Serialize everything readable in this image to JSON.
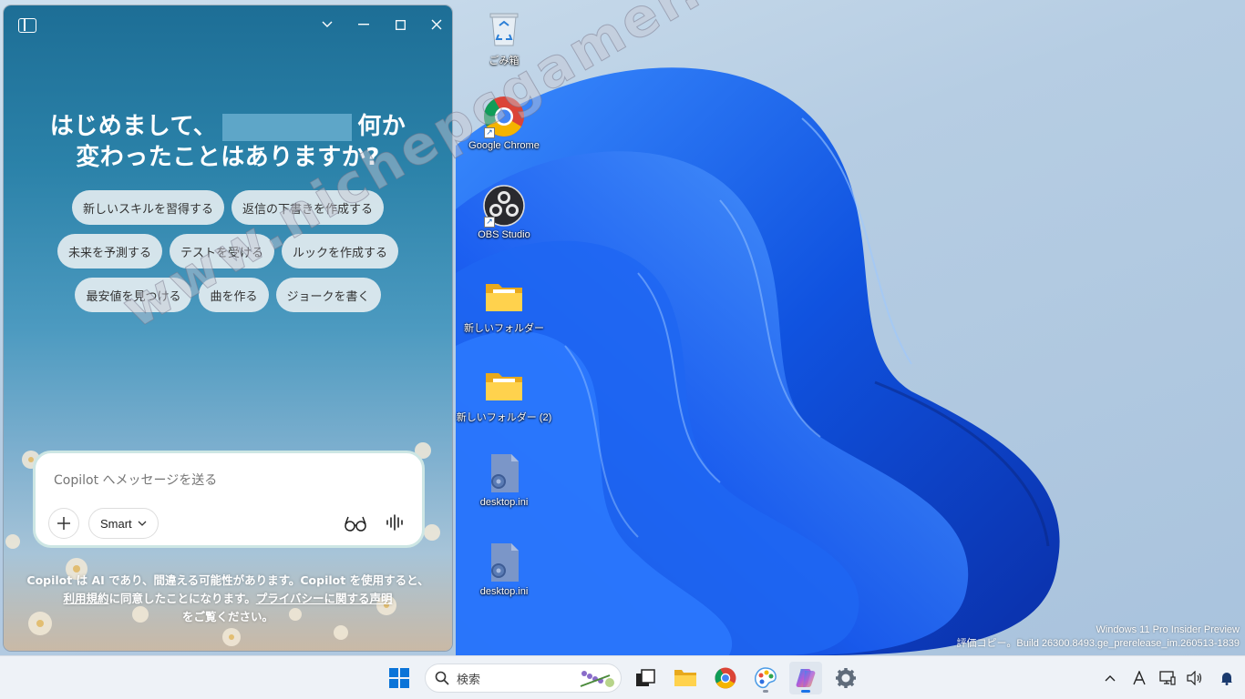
{
  "desktop": {
    "icons": [
      {
        "label": "ごみ箱",
        "icon": "recycle-bin-icon"
      },
      {
        "label": "Google Chrome",
        "icon": "chrome-icon"
      },
      {
        "label": "OBS Studio",
        "icon": "obs-icon"
      },
      {
        "label": "新しいフォルダー",
        "icon": "folder-icon"
      },
      {
        "label": "新しいフォルダー (2)",
        "icon": "folder-icon"
      },
      {
        "label": "desktop.ini",
        "icon": "settings-file-icon"
      },
      {
        "label": "desktop.ini",
        "icon": "settings-file-icon"
      }
    ],
    "build_line1": "Windows 11 Pro Insider Preview",
    "build_line2": "評価コピー。Build 26300.8493.ge_prerelease_im.260513-1839"
  },
  "copilot": {
    "greeting_line1_a": "はじめまして、",
    "greeting_line1_b": "何か",
    "greeting_line2": "変わったことはありますか?",
    "chips_row1": [
      "新しいスキルを習得する",
      "返信の下書きを作成する"
    ],
    "chips_row2": [
      "未来を予測する",
      "テストを受ける",
      "ルックを作成する"
    ],
    "chips_row3": [
      "最安値を見つける",
      "曲を作る",
      "ジョークを書く"
    ],
    "input_placeholder": "Copilot へメッセージを送る",
    "mode_label": "Smart",
    "disclaimer_part1": "Copilot は AI であり、間違える可能性があります。Copilot を使用すると、",
    "terms_link": "利用規約",
    "disclaimer_part2": "に同意したことになります。",
    "privacy_link": "プライバシーに関する声明",
    "disclaimer_part3": "をご覧ください。"
  },
  "watermark": "www.nichepcgamer.com",
  "taskbar": {
    "search_placeholder": "検索",
    "accent_color": "#1a73e8"
  }
}
